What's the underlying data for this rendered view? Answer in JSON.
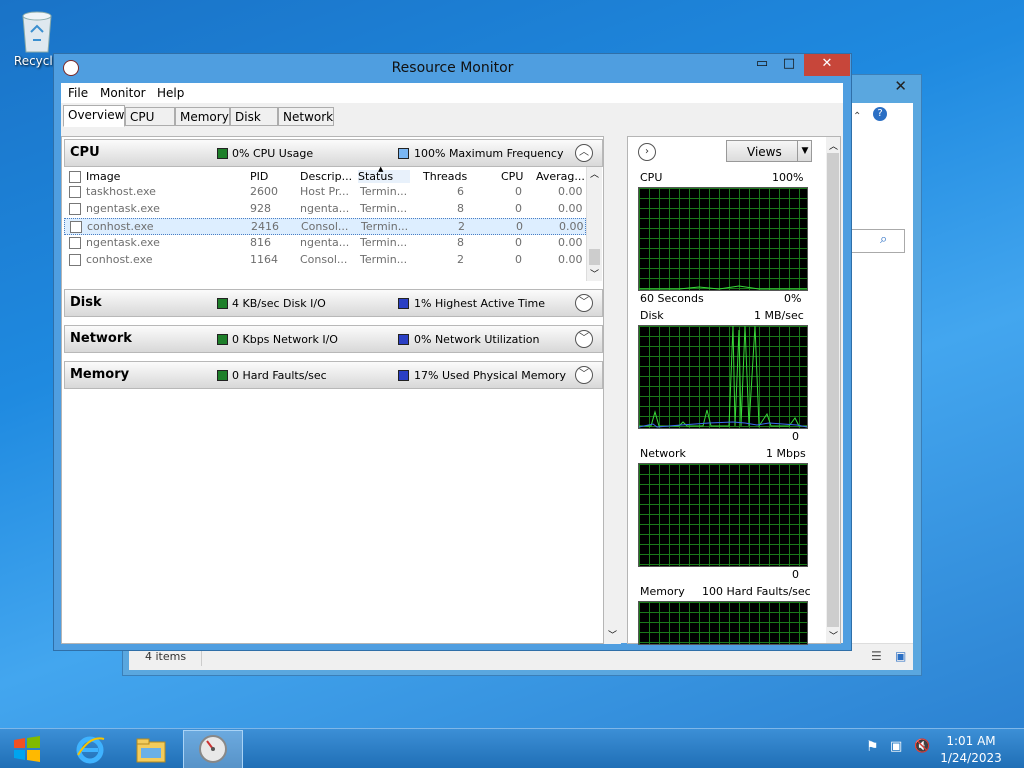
{
  "desktop": {
    "recycle_label": "Recycle"
  },
  "bg_window": {
    "close_glyph": "✕",
    "status_count": "4 items"
  },
  "window": {
    "title": "Resource Monitor",
    "min_glyph": "▭",
    "max_glyph": "□",
    "close_glyph": "✕"
  },
  "menu": [
    "File",
    "Monitor",
    "Help"
  ],
  "tabs": [
    "Overview",
    "CPU",
    "Memory",
    "Disk",
    "Network"
  ],
  "cpu": {
    "title": "CPU",
    "stat1": "0% CPU Usage",
    "stat2": "100% Maximum Frequency",
    "columns": [
      "Image",
      "PID",
      "Descrip...",
      "Status",
      "Threads",
      "CPU",
      "Averag..."
    ],
    "rows": [
      [
        "taskhost.exe",
        "2600",
        "Host Pr...",
        "Termin...",
        "6",
        "0",
        "0.00"
      ],
      [
        "ngentask.exe",
        "928",
        "ngenta...",
        "Termin...",
        "8",
        "0",
        "0.00"
      ],
      [
        "conhost.exe",
        "2416",
        "Consol...",
        "Termin...",
        "2",
        "0",
        "0.00"
      ],
      [
        "ngentask.exe",
        "816",
        "ngenta...",
        "Termin...",
        "8",
        "0",
        "0.00"
      ],
      [
        "conhost.exe",
        "1164",
        "Consol...",
        "Termin...",
        "2",
        "0",
        "0.00"
      ]
    ]
  },
  "disk": {
    "title": "Disk",
    "stat1": "4 KB/sec Disk I/O",
    "stat2": "1% Highest Active Time"
  },
  "network": {
    "title": "Network",
    "stat1": "0 Kbps Network I/O",
    "stat2": "0% Network Utilization"
  },
  "memory": {
    "title": "Memory",
    "stat1": "0 Hard Faults/sec",
    "stat2": "17% Used Physical Memory"
  },
  "right": {
    "views_label": "Views",
    "graphs": [
      {
        "name": "CPU",
        "max": "100%",
        "footer_left": "60 Seconds",
        "footer_right": "0%"
      },
      {
        "name": "Disk",
        "max": "1 MB/sec",
        "footer_left": "",
        "footer_right": "0"
      },
      {
        "name": "Network",
        "max": "1 Mbps",
        "footer_left": "",
        "footer_right": "0"
      },
      {
        "name": "Memory",
        "max": "100 Hard Faults/sec",
        "footer_left": "",
        "footer_right": ""
      }
    ]
  },
  "taskbar": {
    "time": "1:01 AM",
    "date": "1/24/2023"
  },
  "colors": {
    "graph_line": "#39d739",
    "graph_blue": "#3a6cf0",
    "close_red": "#c7463a"
  }
}
